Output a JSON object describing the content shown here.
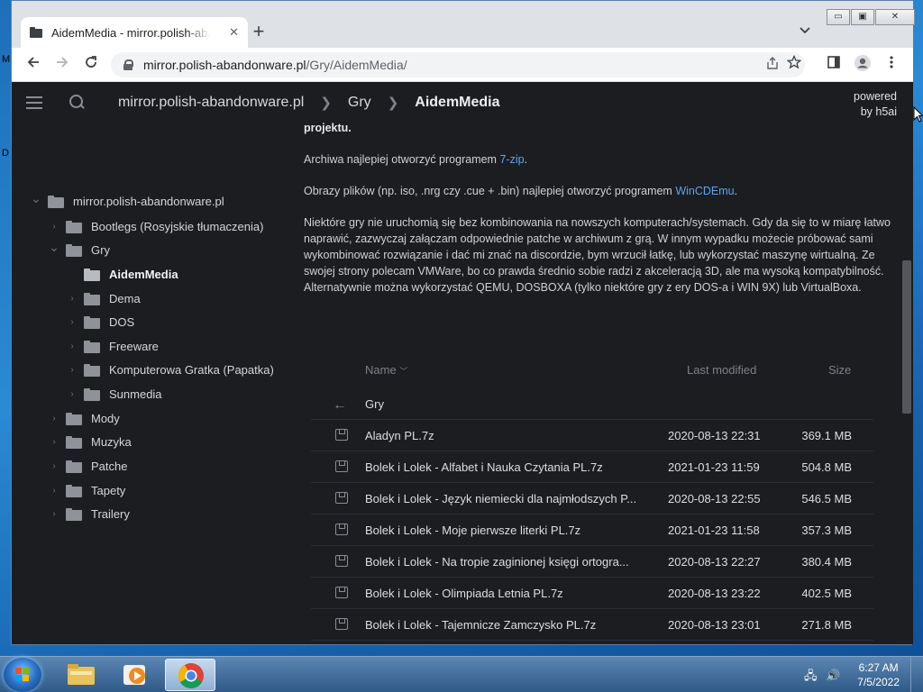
{
  "desktop": {
    "left_chars": [
      "M",
      "D"
    ]
  },
  "browser": {
    "tab_title": "AidemMedia - mirror.polish-abandonware",
    "tab_close": "✕",
    "newtab": "+",
    "url_host": "mirror.polish-abandonware.pl",
    "url_path": "/Gry/AidemMedia/",
    "window_controls": {
      "min": "▭",
      "max": "▣",
      "close": "✕"
    }
  },
  "topbar": {
    "crumbs": [
      "mirror.polish-abandonware.pl",
      "Gry",
      "AidemMedia"
    ],
    "powered_1": "powered",
    "powered_2": "by h5ai"
  },
  "tree": [
    {
      "label": "mirror.polish-abandonware.pl",
      "level": 0,
      "expanded": true
    },
    {
      "label": "Bootlegs (Rosyjskie tłumaczenia)",
      "level": 1,
      "expanded": false
    },
    {
      "label": "Gry",
      "level": 1,
      "expanded": true
    },
    {
      "label": "AidemMedia",
      "level": 2,
      "active": true
    },
    {
      "label": "Dema",
      "level": 2,
      "expanded": false
    },
    {
      "label": "DOS",
      "level": 2,
      "expanded": false
    },
    {
      "label": "Freeware",
      "level": 2,
      "expanded": false
    },
    {
      "label": "Komputerowa Gratka (Papatka)",
      "level": 2,
      "expanded": false
    },
    {
      "label": "Sunmedia",
      "level": 2,
      "expanded": false
    },
    {
      "label": "Mody",
      "level": 1,
      "expanded": false
    },
    {
      "label": "Muzyka",
      "level": 1,
      "expanded": false
    },
    {
      "label": "Patche",
      "level": 1,
      "expanded": false
    },
    {
      "label": "Tapety",
      "level": 1,
      "expanded": false
    },
    {
      "label": "Trailery",
      "level": 1,
      "expanded": false
    }
  ],
  "intro": {
    "p0": "projektu.",
    "p1_a": "Archiwa najlepiej otworzyć programem ",
    "p1_link": "7-zip",
    "p1_b": ".",
    "p2_a": "Obrazy plików (np. iso, .nrg czy .cue + .bin) najlepiej otworzyć programem ",
    "p2_link": "WinCDEmu",
    "p2_b": ".",
    "p3": "Niektóre gry nie uruchomią się bez kombinowania na nowszych komputerach/systemach. Gdy da się to w miarę łatwo naprawić, zazwyczaj załączam odpowiednie patche w archiwum z grą. W innym wypadku możecie próbować sami wykombinować rozwiązanie i dać mi znać na discordzie, bym wrzucił łatkę, lub wykorzystać maszynę wirtualną. Ze swojej strony polecam VMWare, bo co prawda średnio sobie radzi z akceleracją 3D, ale ma wysoką kompatybilność. Alternatywnie można wykorzystać QEMU, DOSBOXA (tylko niektóre gry z ery DOS-a i WIN 9X) lub VirtualBoxa."
  },
  "listing": {
    "col_name": "Name",
    "col_modified": "Last modified",
    "col_size": "Size",
    "parent": "Gry",
    "rows": [
      {
        "name": "Aladyn PL.7z",
        "modified": "2020-08-13 22:31",
        "size": "369.1 MB"
      },
      {
        "name": "Bolek i Lolek - Alfabet i Nauka Czytania PL.7z",
        "modified": "2021-01-23 11:59",
        "size": "504.8 MB"
      },
      {
        "name": "Bolek i Lolek - Język niemiecki dla najmłodszych P...",
        "modified": "2020-08-13 22:55",
        "size": "546.5 MB"
      },
      {
        "name": "Bolek i Lolek - Moje pierwsze literki PL.7z",
        "modified": "2021-01-23 11:58",
        "size": "357.3 MB"
      },
      {
        "name": "Bolek i Lolek - Na tropie zaginionej księgi ortogra...",
        "modified": "2020-08-13 22:27",
        "size": "380.4 MB"
      },
      {
        "name": "Bolek i Lolek - Olimpiada Letnia PL.7z",
        "modified": "2020-08-13 23:22",
        "size": "402.5 MB"
      },
      {
        "name": "Bolek i Lolek - Tajemnicze Zamczysko PL.7z",
        "modified": "2020-08-13 23:01",
        "size": "271.8 MB"
      }
    ]
  },
  "taskbar": {
    "time": "6:27 AM",
    "date": "7/5/2022"
  },
  "colors": {
    "link": "#5aa6ee",
    "page_bg": "#1c1d21"
  }
}
